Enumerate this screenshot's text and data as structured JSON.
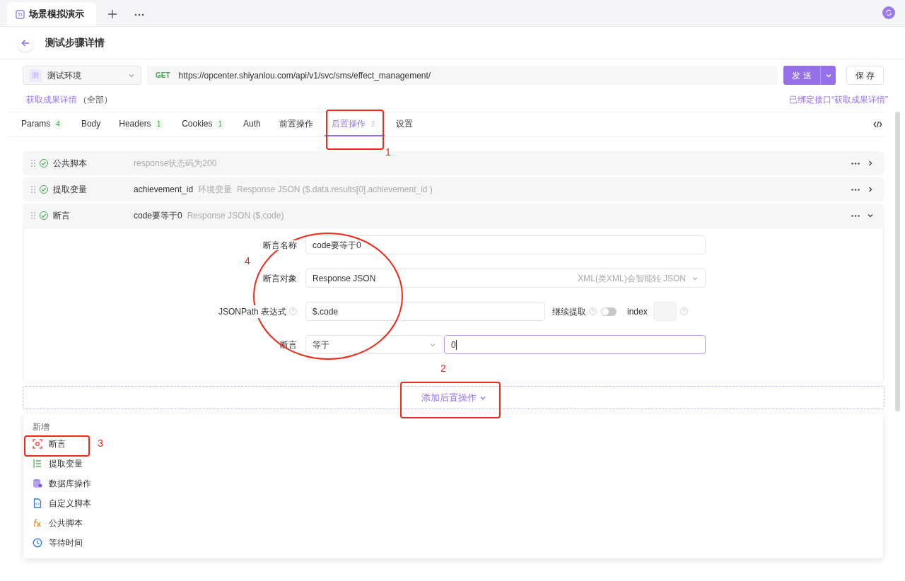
{
  "doc_tab": {
    "title": "场景模拟演示",
    "selected": true
  },
  "header": {
    "title": "测试步骤详情"
  },
  "env": {
    "badge": "测",
    "name": "测试环境"
  },
  "request": {
    "method": "GET",
    "url": "https://opcenter.shiyanlou.com/api/v1/svc/sms/effect_management/"
  },
  "send_label": "发 送",
  "save_label": "保 存",
  "api_link": {
    "name": "获取成果详情",
    "scope": "（全部）"
  },
  "bound_note": "已绑定接口“获取成果详情”",
  "tabs": [
    {
      "label": "Params",
      "count": "4",
      "selected": false
    },
    {
      "label": "Body",
      "selected": false
    },
    {
      "label": "Headers",
      "count": "1",
      "selected": false
    },
    {
      "label": "Cookies",
      "count": "1",
      "selected": false
    },
    {
      "label": "Auth",
      "selected": false
    },
    {
      "label": "前置操作",
      "selected": false
    },
    {
      "label": "后置操作",
      "count": "3",
      "selected": true
    },
    {
      "label": "设置",
      "selected": false
    }
  ],
  "operations": [
    {
      "type": "公共脚本",
      "enabled": true,
      "expanded": false,
      "summary": [
        {
          "text": "response状态码为200",
          "muted": true
        }
      ]
    },
    {
      "type": "提取变量",
      "enabled": true,
      "expanded": false,
      "summary": [
        {
          "text": "achievement_id",
          "muted": false
        },
        {
          "text": "环境变量",
          "muted": true
        },
        {
          "text": "Response JSON ($.data.results[0].achievement_id )",
          "muted": true
        }
      ]
    },
    {
      "type": "断言",
      "enabled": true,
      "expanded": true,
      "summary": [
        {
          "text": "code要等于0",
          "muted": false
        },
        {
          "text": "Response JSON ($.code)",
          "muted": true
        }
      ]
    }
  ],
  "assert_form": {
    "name_label": "断言名称",
    "name_value": "code要等于0",
    "target_label": "断言对象",
    "target_value": "Response JSON",
    "target_hint": "XML(类XML)会智能转 JSON",
    "path_label": "JSONPath 表达式",
    "path_value": "$.code",
    "continue_label": "继续提取",
    "continue_on": false,
    "index_label": "index",
    "assert_label": "断言",
    "op_value": "等于",
    "expected_value": "0"
  },
  "add_button": "添加后置操作",
  "menu": {
    "header": "新增",
    "items": [
      {
        "kind": "assert",
        "label": "断言"
      },
      {
        "kind": "extract",
        "label": "提取变量"
      },
      {
        "kind": "database",
        "label": "数据库操作"
      },
      {
        "kind": "custom",
        "label": "自定义脚本"
      },
      {
        "kind": "fx",
        "label": "公共脚本"
      },
      {
        "kind": "wait",
        "label": "等待时间"
      }
    ]
  },
  "annotations": [
    "1",
    "2",
    "3",
    "4"
  ]
}
